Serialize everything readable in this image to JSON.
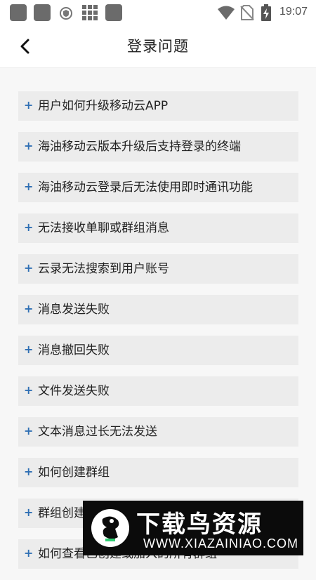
{
  "status_bar": {
    "time": "19:07",
    "left_icons": [
      "app-square-icon",
      "app-square-icon",
      "shield-icon",
      "grid-icon",
      "app-square-icon"
    ],
    "right_icons": [
      "wifi-icon",
      "no-sim-icon",
      "battery-charging-icon"
    ]
  },
  "header": {
    "title": "登录问题",
    "back_icon": "chevron-left-icon"
  },
  "faq": {
    "expand_symbol": "+",
    "accent_color": "#2f6fb4",
    "items": [
      {
        "label": "用户如何升级移动云APP"
      },
      {
        "label": "海油移动云版本升级后支持登录的终端"
      },
      {
        "label": "海油移动云登录后无法使用即时通讯功能"
      },
      {
        "label": "无法接收单聊或群组消息"
      },
      {
        "label": "云录无法搜索到用户账号"
      },
      {
        "label": "消息发送失败"
      },
      {
        "label": "消息撤回失败"
      },
      {
        "label": "文件发送失败"
      },
      {
        "label": "文本消息过长无法发送"
      },
      {
        "label": "如何创建群组"
      },
      {
        "label": "群组创建"
      },
      {
        "label": "如何查看已创建或加入的所有群组"
      }
    ]
  },
  "watermark": {
    "title": "下载鸟资源",
    "url": "WWW.XIAZAINIAO.COM"
  }
}
